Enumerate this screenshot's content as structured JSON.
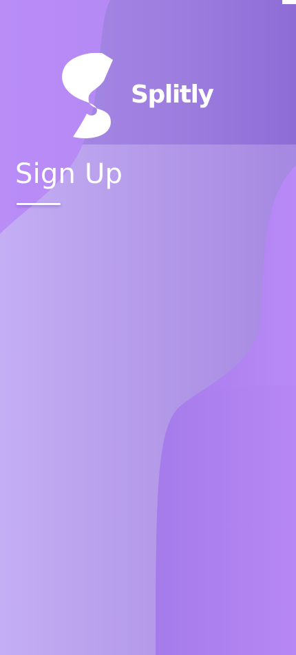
{
  "app": {
    "brand_name": "Splitly",
    "logo_icon": "splitly-s-logo-icon"
  },
  "page": {
    "title": "Sign Up"
  },
  "colors": {
    "background_dark": "#9171d8",
    "background_mid": "#b28ef0",
    "background_light": "#c2a8f3",
    "foreground_text": "#ffffff"
  }
}
